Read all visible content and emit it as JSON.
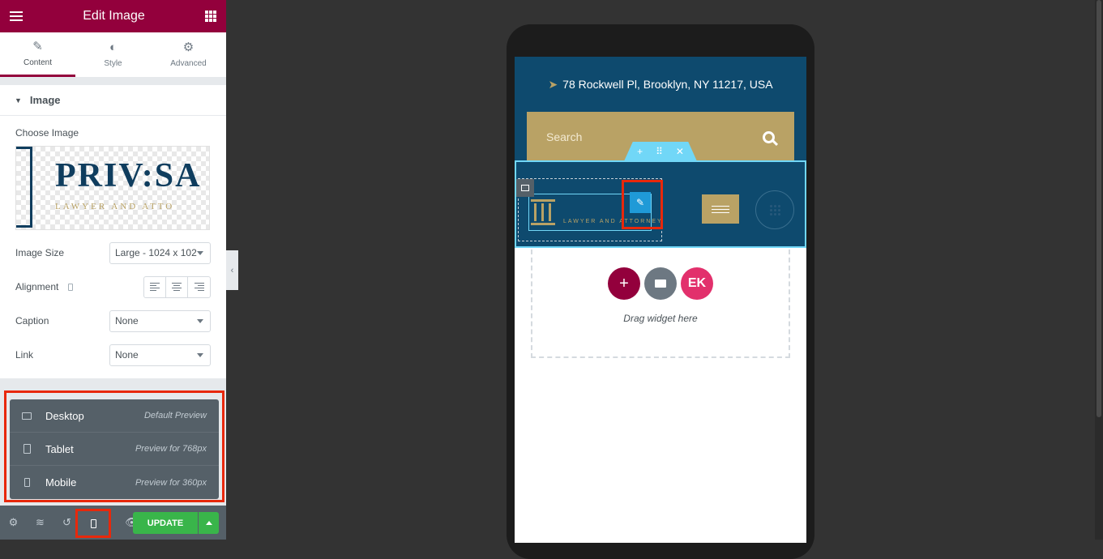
{
  "panel": {
    "title": "Edit Image",
    "tabs": [
      {
        "label": "Content",
        "icon": "pencil-icon"
      },
      {
        "label": "Style",
        "icon": "half-circle-icon"
      },
      {
        "label": "Advanced",
        "icon": "gear-icon"
      }
    ],
    "section_title": "Image",
    "choose_image_label": "Choose Image",
    "preview_logo": {
      "main": "PRIV:SA",
      "sub": "LAWYER AND ATTO"
    },
    "image_size": {
      "label": "Image Size",
      "value": "Large - 1024 x 102"
    },
    "alignment": {
      "label": "Alignment"
    },
    "caption": {
      "label": "Caption",
      "value": "None"
    },
    "link": {
      "label": "Link",
      "value": "None"
    },
    "accent_color": "#93003c"
  },
  "responsive_menu": [
    {
      "name": "Desktop",
      "description": "Default Preview",
      "icon": "desktop-icon"
    },
    {
      "name": "Tablet",
      "description": "Preview for 768px",
      "icon": "tablet-icon"
    },
    {
      "name": "Mobile",
      "description": "Preview for 360px",
      "icon": "mobile-icon"
    }
  ],
  "footer": {
    "update_label": "UPDATE",
    "update_color": "#39b54a"
  },
  "preview": {
    "address": "78 Rockwell Pl, Brooklyn, NY 11217, USA",
    "search_placeholder": "Search",
    "mini_logo_text": "LAWYER AND ATTORNEY",
    "drag_text": "Drag widget here",
    "header_color": "#0e4a6e",
    "gold_color": "#b9a265"
  },
  "highlight_color": "#e8280b"
}
